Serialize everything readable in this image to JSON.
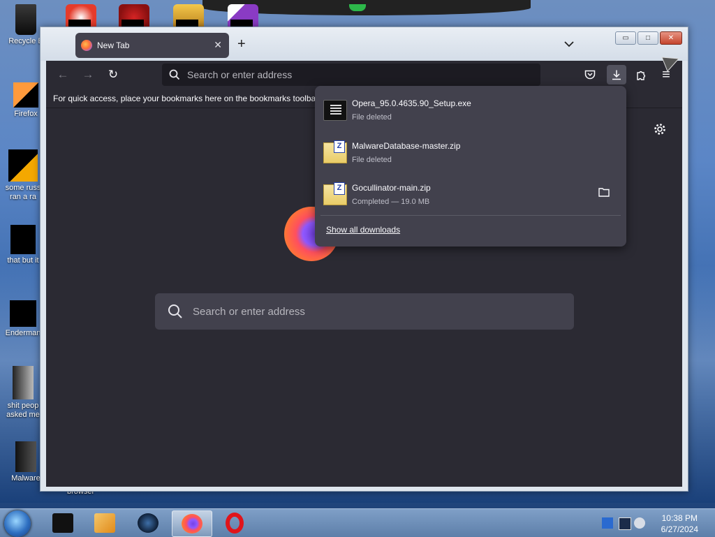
{
  "desktop": {
    "icons": [
      {
        "label": "Recycle B",
        "icon": "recycle-bin-icon"
      },
      {
        "label": "Firefox",
        "icon": "firefox-icon"
      },
      {
        "label": "some russ",
        "label2": "ran a ra",
        "icon": "file-icon"
      },
      {
        "label": "that but it",
        "icon": "shortcut-icon"
      },
      {
        "label": "Enderman",
        "icon": "folder-icon"
      },
      {
        "label": "shit peop",
        "label2": "asked me",
        "icon": "folder-icon"
      },
      {
        "label": "Malware",
        "icon": "folder-icon"
      }
    ],
    "behind_window_label": "browser"
  },
  "window": {
    "tab": {
      "title": "New Tab",
      "icon": "firefox-icon"
    },
    "new_tab_symbol": "+",
    "list_tabs_symbol": "⌄",
    "controls": {
      "minimize": "▭",
      "maximize": "□",
      "close": "✕"
    }
  },
  "navbar": {
    "back_symbol": "←",
    "forward_symbol": "→",
    "reload_symbol": "↻",
    "url_placeholder": "Search or enter address",
    "pocket_icon": "pocket-icon",
    "downloads_icon": "download-icon",
    "extensions_icon": "puzzle-icon",
    "menu_symbol": "≡"
  },
  "bookmarks_bar": {
    "message": "For quick access, place your bookmarks here on the bookmarks toolbar."
  },
  "newtab": {
    "search_placeholder": "Search or enter address",
    "settings_icon": "gear-icon"
  },
  "downloads": {
    "items": [
      {
        "name": "Opera_95.0.4635.90_Setup.exe",
        "status": "File deleted",
        "icon": "exe-icon"
      },
      {
        "name": "MalwareDatabase-master.zip",
        "status": "File deleted",
        "icon": "zip-icon"
      },
      {
        "name": "Gocullinator-main.zip",
        "status": "Completed — 19.0 MB",
        "icon": "zip-icon"
      }
    ],
    "show_all": "Show all downloads"
  },
  "taskbar": {
    "apps": [
      "terminal",
      "media-player",
      "steam",
      "firefox",
      "opera"
    ],
    "active_app": "firefox",
    "time": "10:38 PM",
    "date": "6/27/2024"
  },
  "colors": {
    "toolbar": "#2b2a33",
    "panel": "#42414d",
    "urlbar": "#1c1b22",
    "text": "#fbfbfe"
  }
}
